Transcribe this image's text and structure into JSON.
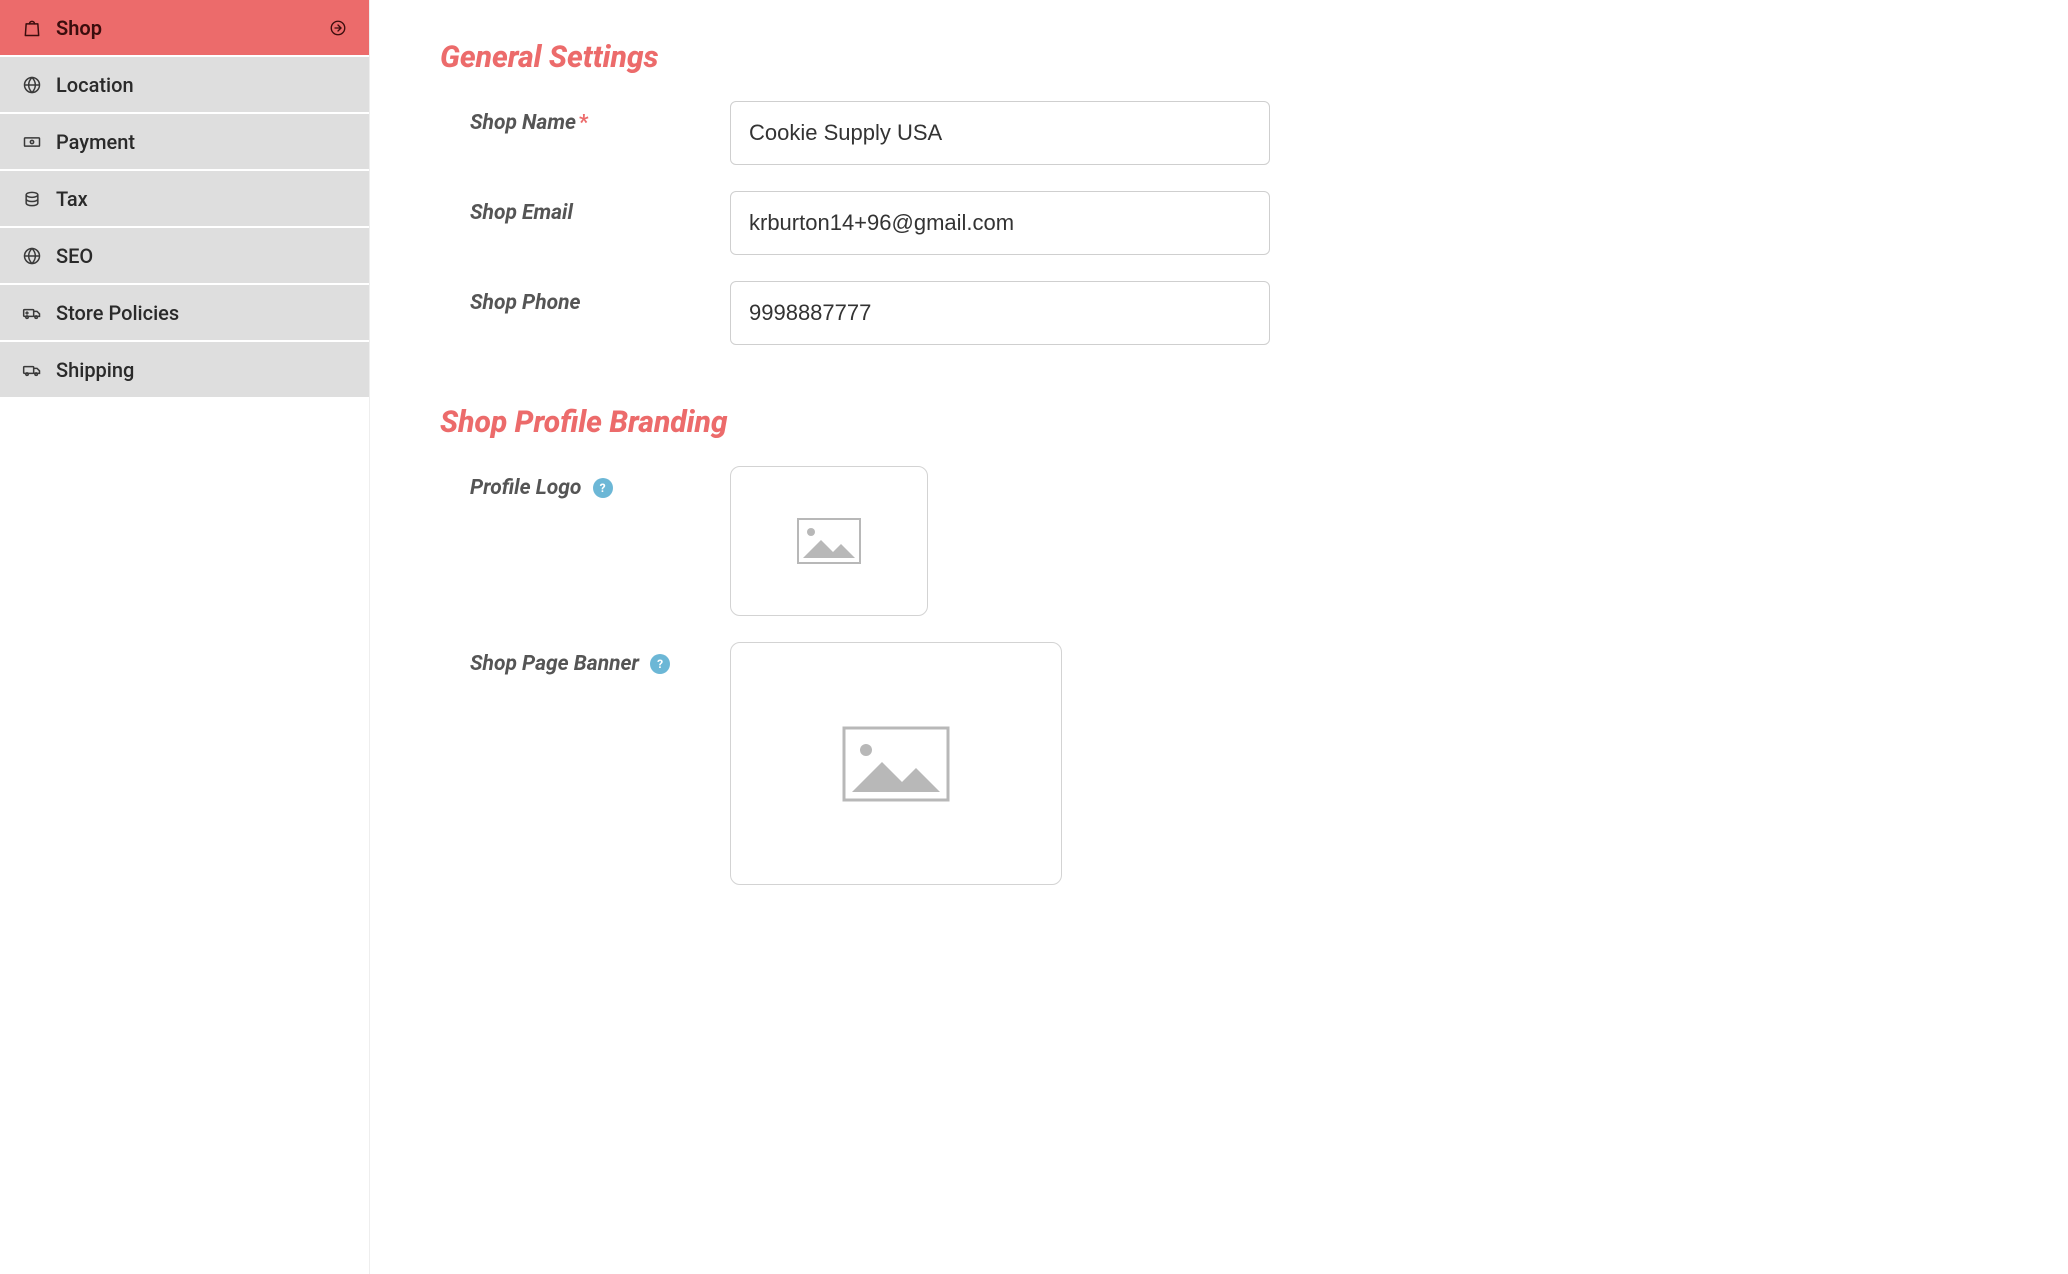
{
  "sidebar": {
    "items": [
      {
        "label": "Shop"
      },
      {
        "label": "Location"
      },
      {
        "label": "Payment"
      },
      {
        "label": "Tax"
      },
      {
        "label": "SEO"
      },
      {
        "label": "Store Policies"
      },
      {
        "label": "Shipping"
      }
    ]
  },
  "sections": {
    "general_title": "General Settings",
    "branding_title": "Shop Profile Branding"
  },
  "fields": {
    "shop_name": {
      "label": "Shop Name",
      "value": "Cookie Supply USA"
    },
    "shop_email": {
      "label": "Shop Email",
      "value": "krburton14+96@gmail.com"
    },
    "shop_phone": {
      "label": "Shop Phone",
      "value": "9998887777"
    },
    "profile_logo": {
      "label": "Profile Logo"
    },
    "shop_banner": {
      "label": "Shop Page Banner"
    }
  },
  "help_glyph": "?"
}
